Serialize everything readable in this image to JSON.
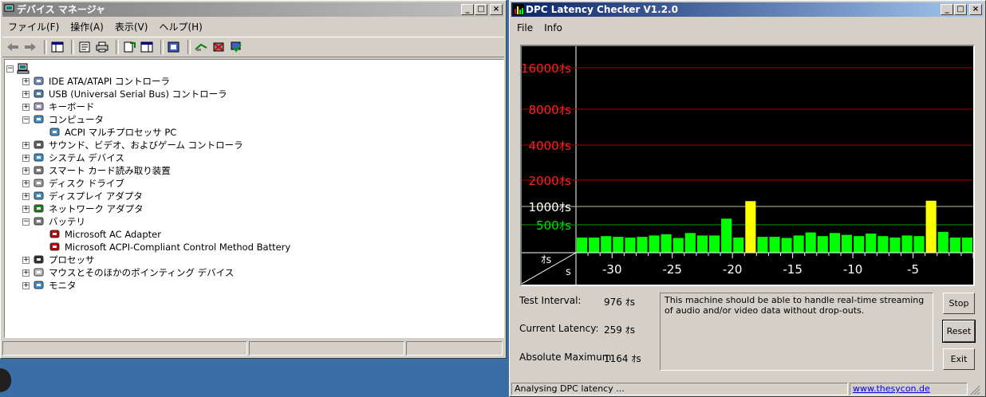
{
  "devmgr": {
    "title": "デバイス マネージャ",
    "menu": [
      "ファイル(F)",
      "操作(A)",
      "表示(V)",
      "ヘルプ(H)"
    ],
    "tree": [
      {
        "label": "IDE ATA/ATAPI コントローラ",
        "level": 1,
        "exp": "+"
      },
      {
        "label": "USB (Universal Serial Bus) コントローラ",
        "level": 1,
        "exp": "+"
      },
      {
        "label": "キーボード",
        "level": 1,
        "exp": "+"
      },
      {
        "label": "コンピュータ",
        "level": 1,
        "exp": "-"
      },
      {
        "label": "ACPI マルチプロセッサ PC",
        "level": 2,
        "exp": ""
      },
      {
        "label": "サウンド、ビデオ、およびゲーム コントローラ",
        "level": 1,
        "exp": "+"
      },
      {
        "label": "システム デバイス",
        "level": 1,
        "exp": "+"
      },
      {
        "label": "スマート カード読み取り装置",
        "level": 1,
        "exp": "+"
      },
      {
        "label": "ディスク ドライブ",
        "level": 1,
        "exp": "+"
      },
      {
        "label": "ディスプレイ アダプタ",
        "level": 1,
        "exp": "+"
      },
      {
        "label": "ネットワーク アダプタ",
        "level": 1,
        "exp": "+"
      },
      {
        "label": "バッテリ",
        "level": 1,
        "exp": "-"
      },
      {
        "label": "Microsoft AC Adapter",
        "level": 2,
        "exp": ""
      },
      {
        "label": "Microsoft ACPI-Compliant Control Method Battery",
        "level": 2,
        "exp": ""
      },
      {
        "label": "プロセッサ",
        "level": 1,
        "exp": "+"
      },
      {
        "label": "マウスとそのほかのポインティング デバイス",
        "level": 1,
        "exp": "+"
      },
      {
        "label": "モニタ",
        "level": 1,
        "exp": "+"
      }
    ]
  },
  "dpc": {
    "title": "DPC Latency Checker V1.2.0",
    "menu": [
      "File",
      "Info"
    ],
    "labels": {
      "test_interval": "Test Interval:",
      "test_interval_value": "976 ｵs",
      "current_latency": "Current Latency:",
      "current_latency_value": "259 ｵs",
      "absolute_max": "Absolute Maximum:",
      "absolute_max_value": "1164 ｵs"
    },
    "message": "This machine should be able to handle real-time streaming of audio and/or video data without drop-outs.",
    "buttons": {
      "stop": "Stop",
      "reset": "Reset",
      "exit": "Exit"
    },
    "status": "Analysing DPC latency ...",
    "link": "www.thesycon.de",
    "colors": {
      "green": "#00ff00",
      "yellow": "#ffff00",
      "red_line": "#a00000",
      "red_label": "#ff2020",
      "green_label": "#00e000",
      "white_label": "#ffffff"
    }
  },
  "chart_data": {
    "type": "bar",
    "ylabel": "ｵs",
    "xlabel": "s",
    "y_ticks": [
      {
        "label": "16000ｵs",
        "value": 16000,
        "color": "red"
      },
      {
        "label": "8000ｵs",
        "value": 8000,
        "color": "red"
      },
      {
        "label": "4000ｵs",
        "value": 4000,
        "color": "red"
      },
      {
        "label": "2000ｵs",
        "value": 2000,
        "color": "red"
      },
      {
        "label": "1000ｵs",
        "value": 1000,
        "color": "white"
      },
      {
        "label": "500ｵs",
        "value": 500,
        "color": "green"
      }
    ],
    "x_ticks": [
      "-30",
      "-25",
      "-20",
      "-15",
      "-10",
      "-5"
    ],
    "x_tick_values": [
      -30,
      -25,
      -20,
      -15,
      -10,
      -5
    ],
    "xlim": [
      -33,
      0
    ],
    "x": [
      -32.5,
      -31.5,
      -30.5,
      -29.5,
      -28.5,
      -27.5,
      -26.5,
      -25.5,
      -24.5,
      -23.5,
      -22.5,
      -21.5,
      -20.5,
      -19.5,
      -18.5,
      -17.5,
      -16.5,
      -15.5,
      -14.5,
      -13.5,
      -12.5,
      -11.5,
      -10.5,
      -9.5,
      -8.5,
      -7.5,
      -6.5,
      -5.5,
      -4.5,
      -3.5,
      -2.5,
      -1.5,
      -0.5
    ],
    "values": [
      250,
      250,
      270,
      260,
      250,
      260,
      280,
      300,
      240,
      320,
      280,
      280,
      630,
      250,
      1150,
      260,
      260,
      240,
      280,
      330,
      270,
      320,
      290,
      270,
      310,
      270,
      250,
      280,
      270,
      1164,
      340,
      250,
      250
    ],
    "highlight": [
      false,
      false,
      false,
      false,
      false,
      false,
      false,
      false,
      false,
      false,
      false,
      false,
      false,
      false,
      true,
      false,
      false,
      false,
      false,
      false,
      false,
      false,
      false,
      false,
      false,
      false,
      false,
      false,
      false,
      true,
      false,
      false,
      false
    ]
  }
}
